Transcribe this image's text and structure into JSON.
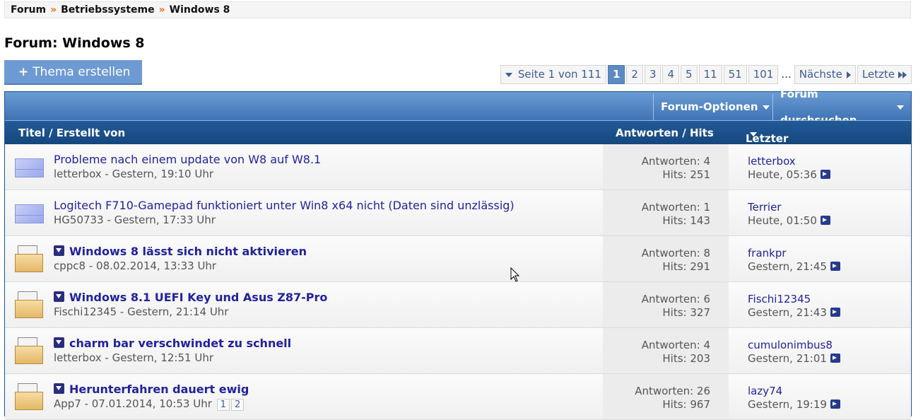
{
  "breadcrumb": {
    "items": [
      "Forum",
      "Betriebssysteme",
      "Windows 8"
    ],
    "separator": "»"
  },
  "page_title": "Forum: Windows 8",
  "new_thread": {
    "plus": "+",
    "label": "Thema erstellen"
  },
  "pagination": {
    "page_info": "Seite 1 von 111",
    "pages": [
      "1",
      "2",
      "3",
      "4",
      "5",
      "11",
      "51",
      "101"
    ],
    "current": "1",
    "ellipsis": "...",
    "next": "Nächste",
    "last": "Letzte"
  },
  "topbar": {
    "options": "Forum-Optionen",
    "search": "Forum durchsuchen"
  },
  "table_header": {
    "title": "Titel / Erstellt von",
    "stats": "Antworten / Hits",
    "last": "Letzter Beitrag von"
  },
  "threads": [
    {
      "title": "Probleme nach einem update von W8 auf W8.1",
      "meta": "letterbox - Gestern, 19:10 Uhr",
      "answers": "Antworten: 4",
      "hits": "Hits: 251",
      "last_user": "letterbox",
      "last_time": "Heute, 05:36",
      "icon": "new-envelope-icon",
      "sticky": false
    },
    {
      "title": "Logitech F710-Gamepad funktioniert unter Win8 x64 nicht (Daten sind unzlässig)",
      "meta": "HG50733 - Gestern, 17:33 Uhr",
      "answers": "Antworten: 1",
      "hits": "Hits: 143",
      "last_user": "Terrier",
      "last_time": "Heute, 01:50",
      "icon": "new-envelope-icon",
      "sticky": false
    },
    {
      "title": "Windows 8 lässt sich nicht aktivieren",
      "meta": "cppc8 - 08.02.2014, 13:33 Uhr",
      "answers": "Antworten: 8",
      "hits": "Hits: 291",
      "last_user": "frankpr",
      "last_time": "Gestern, 21:45",
      "icon": "read-envelope-icon",
      "sticky": true
    },
    {
      "title": "Windows 8.1 UEFI Key und Asus Z87-Pro",
      "meta": "Fischi12345 - Gestern, 21:14 Uhr",
      "answers": "Antworten: 6",
      "hits": "Hits: 327",
      "last_user": "Fischi12345",
      "last_time": "Gestern, 21:43",
      "icon": "read-envelope-icon",
      "sticky": true
    },
    {
      "title": "charm bar verschwindet zu schnell",
      "meta": "letterbox - Gestern, 12:51 Uhr",
      "answers": "Antworten: 4",
      "hits": "Hits: 203",
      "last_user": "cumulonimbus8",
      "last_time": "Gestern, 21:01",
      "icon": "read-envelope-icon",
      "sticky": true
    },
    {
      "title": "Herunterfahren dauert ewig",
      "meta": "App7 - 07.01.2014, 10:53 Uhr",
      "answers": "Antworten: 26",
      "hits": "Hits: 967",
      "last_user": "lazy74",
      "last_time": "Gestern, 19:19",
      "icon": "read-envelope-icon",
      "sticky": true,
      "mini_pages": [
        "1",
        "2"
      ]
    }
  ]
}
